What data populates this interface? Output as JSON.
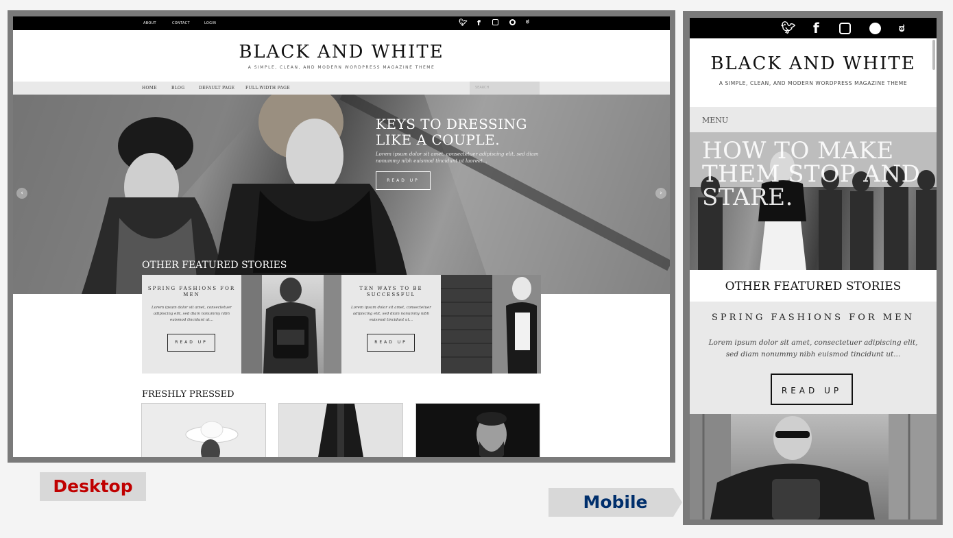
{
  "desktop": {
    "top_links": [
      "ABOUT",
      "CONTACT",
      "LOGIN"
    ],
    "social_icons": [
      "twitter-icon",
      "facebook-icon",
      "instagram-icon",
      "snapchat-icon",
      "weibo-icon"
    ],
    "site_title": "BLACK AND WHITE",
    "tagline": "A SIMPLE, CLEAN, AND MODERN WORDPRESS MAGAZINE THEME",
    "nav": [
      "HOME",
      "BLOG",
      "DEFAULT PAGE",
      "FULL-WIDTH PAGE"
    ],
    "search_placeholder": "SEARCH",
    "hero": {
      "title_line1": "KEYS TO DRESSING",
      "title_line2": "LIKE A COUPLE.",
      "text": "Lorem ipsum dolor sit amet, consectetuer adipiscing elit, sed diam nonummy nibh euismod tincidunt ut laoreet...",
      "button": "READ UP",
      "prev_arrow": "‹",
      "next_arrow": "›"
    },
    "featured_heading": "OTHER FEATURED STORIES",
    "featured": [
      {
        "title": "SPRING FASHIONS FOR MEN",
        "text": "Lorem ipsum dolor sit amet, consectetuer adipiscing elit, sed diam nonummy nibh euismod tincidunt ut...",
        "button": "READ UP"
      },
      {
        "title": "TEN WAYS TO BE SUCCESSFUL",
        "text": "Lorem ipsum dolor sit amet, consectetuer adipiscing elit, sed diam nonummy nibh euismod tincidunt ut...",
        "button": "READ UP"
      }
    ],
    "freshly_pressed_heading": "FRESHLY PRESSED"
  },
  "mobile": {
    "social_icons": [
      "twitter-icon",
      "facebook-icon",
      "instagram-icon",
      "snapchat-icon",
      "weibo-icon"
    ],
    "site_title": "BLACK AND WHITE",
    "tagline": "A SIMPLE, CLEAN, AND MODERN WORDPRESS MAGAZINE THEME",
    "menu_label": "MENU",
    "hero_title": "HOW TO MAKE THEM STOP AND STARE.",
    "featured_heading": "OTHER FEATURED STORIES",
    "card": {
      "title": "SPRING FASHIONS FOR MEN",
      "text": "Lorem ipsum dolor sit amet, consectetuer adipiscing elit, sed diam nonummy nibh euismod tincidunt ut...",
      "button": "READ UP"
    }
  },
  "labels": {
    "desktop": "Desktop",
    "mobile": "Mobile"
  },
  "colors": {
    "desktop_label": "#c00000",
    "mobile_label": "#002f6c",
    "frame": "#7a7a7a"
  }
}
